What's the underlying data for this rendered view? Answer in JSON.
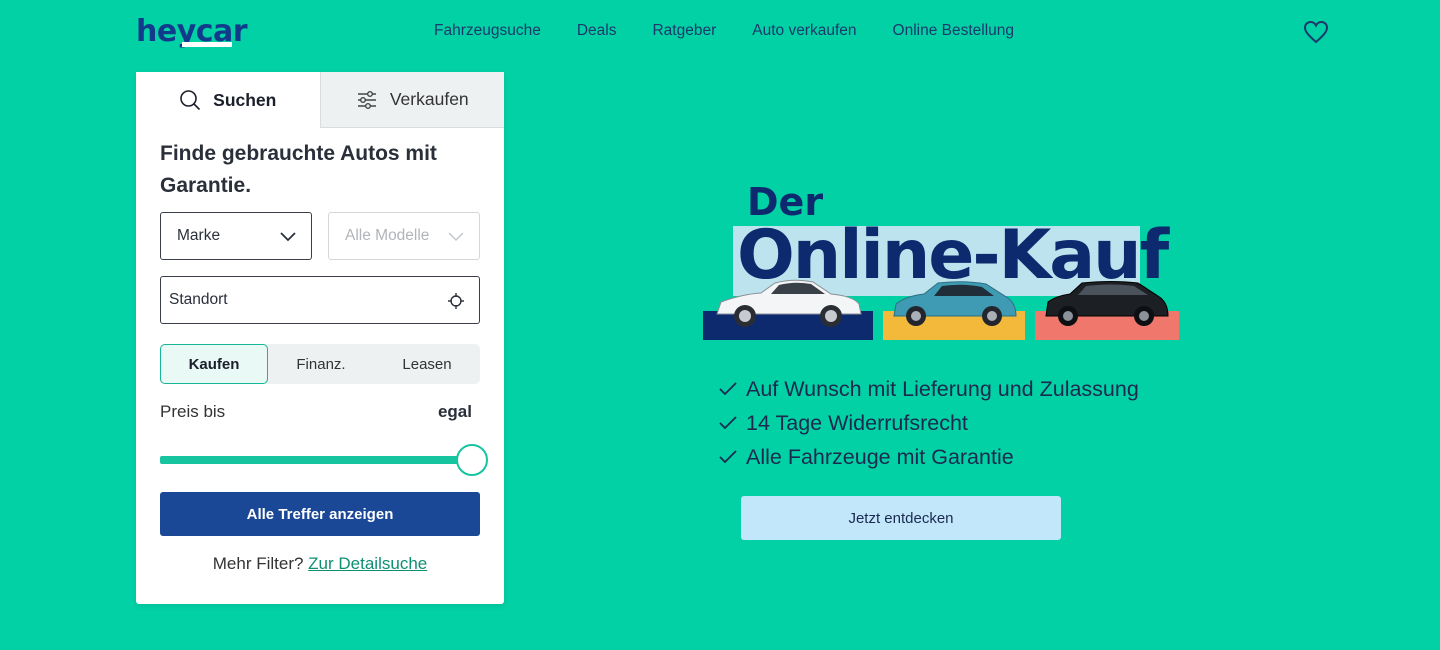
{
  "header": {
    "logo": "heycar",
    "nav": [
      "Fahrzeugsuche",
      "Deals",
      "Ratgeber",
      "Auto verkaufen",
      "Online Bestellung"
    ]
  },
  "search": {
    "tabs": [
      "Suchen",
      "Verkaufen"
    ],
    "title": "Finde gebrauchte Autos mit Garantie.",
    "make_select": "Marke",
    "model_select": "Alle Modelle",
    "location_value": "Standort",
    "payment_options": [
      "Kaufen",
      "Finanz.",
      "Leasen"
    ],
    "selected_payment": "Kaufen",
    "price_label": "Preis bis",
    "price_value": "egal",
    "price_slider_fraction": 1.0,
    "cta_label": "Alle Treffer anzeigen",
    "more_prefix": "Mehr Filter?",
    "more_link": "Zur Detailsuche"
  },
  "hero": {
    "line1": "Der",
    "line2": "Online-Kauf",
    "benefits": [
      "Auf Wunsch mit Lieferung und Zulassung",
      "14 Tage Widerrufsrecht",
      "Alle Fahrzeuge mit Garantie"
    ],
    "cta_label": "Jetzt entdecken"
  },
  "colors": {
    "background": "#02d0a5",
    "brand_navy": "#1a4796",
    "slider": "#17c4a0",
    "hero_cta": "#c2e7fb"
  }
}
